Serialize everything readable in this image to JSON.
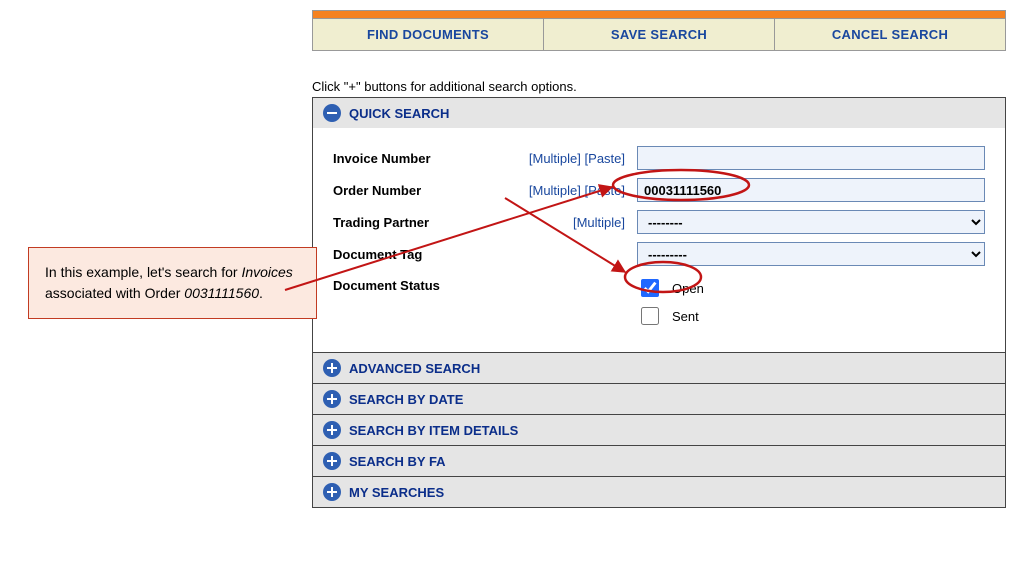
{
  "toolbar": {
    "find": "FIND DOCUMENTS",
    "save": "SAVE SEARCH",
    "cancel": "CANCEL SEARCH"
  },
  "hint": "Click \"+\" buttons for additional search options.",
  "sections": {
    "quick": "QUICK SEARCH",
    "advanced": "ADVANCED SEARCH",
    "bydate": "SEARCH BY DATE",
    "byitem": "SEARCH BY ITEM DETAILS",
    "byfa": "SEARCH BY FA",
    "mysearches": "MY SEARCHES"
  },
  "labels": {
    "invoice_number": "Invoice Number",
    "order_number": "Order Number",
    "trading_partner": "Trading Partner",
    "document_tag": "Document Tag",
    "document_status": "Document Status"
  },
  "links": {
    "multiple": "[Multiple]",
    "paste": "[Paste]"
  },
  "fields": {
    "invoice_number": "",
    "order_number": "00031111560",
    "trading_partner_selected": "--------",
    "document_tag_selected": "---------"
  },
  "status": {
    "open": {
      "label": "Open",
      "checked": true
    },
    "sent": {
      "label": "Sent",
      "checked": false
    }
  },
  "callout": {
    "line1_pre": "In this example, let's search for ",
    "line1_em": "Invoices",
    "line1_post": " associated with Order ",
    "line2_em": "0031111560",
    "line2_post": "."
  }
}
